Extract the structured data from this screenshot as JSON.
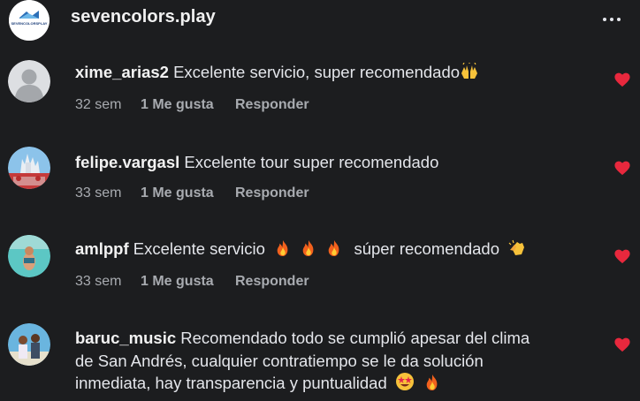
{
  "header": {
    "account_name": "sevencolors.play",
    "logo_text": "SEVENCOLORSPLAY",
    "more_icon": "more-horizontal-icon"
  },
  "colors": {
    "background": "#1c1d1f",
    "heart": "#e8283d",
    "meta_text": "#a8abb0"
  },
  "comments": [
    {
      "username": "xime_arias2",
      "text": "Excelente servicio, super recomendado",
      "emojis": [
        "raising-hands-emoji"
      ],
      "time": "32 sem",
      "likes": "1 Me gusta",
      "reply": "Responder",
      "liked": true
    },
    {
      "username": "felipe.vargasl",
      "text": "Excelente tour super recomendado",
      "emojis": [],
      "time": "33 sem",
      "likes": "1 Me gusta",
      "reply": "Responder",
      "liked": true
    },
    {
      "username": "amlppf",
      "text_a": "Excelente servicio",
      "text_b": "súper recomendado",
      "emojis": [
        "fire-emoji",
        "fire-emoji",
        "fire-emoji",
        "clapping-hands-emoji"
      ],
      "time": "33 sem",
      "likes": "1 Me gusta",
      "reply": "Responder",
      "liked": true
    },
    {
      "username": "baruc_music",
      "text_line1": "Recomendado todo se cumplió apesar del clima",
      "text_line2": "de San Andrés, cualquier contratiempo se le da solución",
      "text_line3": "inmediata, hay transparencia y puntualidad",
      "emojis": [
        "star-struck-emoji",
        "fire-emoji"
      ],
      "liked": true
    }
  ]
}
